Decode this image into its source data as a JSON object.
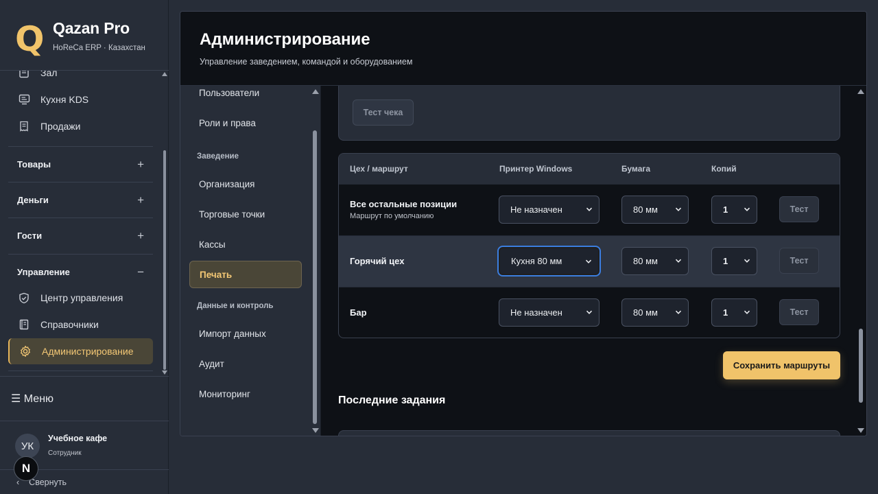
{
  "brand": {
    "logo_letter": "Q",
    "name": "Qazan Pro",
    "subtitle": "HoReCa ERP · Казахстан"
  },
  "sidebar": {
    "items_top": [
      {
        "label": "Зал",
        "icon": "hall-icon"
      },
      {
        "label": "Кухня KDS",
        "icon": "kds-monitor-icon"
      },
      {
        "label": "Продажи",
        "icon": "receipt-icon"
      }
    ],
    "groups": [
      {
        "label": "Товары",
        "toggle": "+"
      },
      {
        "label": "Деньги",
        "toggle": "+"
      },
      {
        "label": "Гости",
        "toggle": "+"
      },
      {
        "label": "Управление",
        "toggle": "−"
      }
    ],
    "items_management": [
      {
        "label": "Центр управления",
        "icon": "shield-check-icon"
      },
      {
        "label": "Справочники",
        "icon": "book-icon"
      },
      {
        "label": "Администрирование",
        "icon": "gear-icon",
        "active": true
      }
    ],
    "menu_label": "☰ Меню",
    "user": {
      "initials": "УК",
      "name": "Учебное кафе",
      "role": "Сотрудник"
    },
    "collapse_label": "Свернуть",
    "collapse_chevron": "‹",
    "n_badge": "N"
  },
  "page": {
    "title": "Администрирование",
    "subtitle": "Управление заведением, командой и оборудованием"
  },
  "subnav": {
    "items_top": [
      "Пользователи",
      "Роли и права"
    ],
    "section_venue": "Заведение",
    "items_venue": [
      "Организация",
      "Торговые точки",
      "Кассы",
      "Печать"
    ],
    "active": "Печать",
    "section_data": "Данные и контроль",
    "items_data": [
      "Импорт данных",
      "Аудит",
      "Мониторинг"
    ]
  },
  "printing": {
    "test_receipt_label": "Тест чека",
    "table_headers": {
      "route": "Цех / маршрут",
      "printer": "Принтер Windows",
      "paper": "Бумага",
      "copies": "Копий"
    },
    "rows": [
      {
        "name": "Все остальные позиции",
        "sub": "Маршрут по умолчанию",
        "printer": "Не назначен",
        "paper": "80 мм",
        "copies": "1",
        "test": "Тест"
      },
      {
        "name": "Горячий цех",
        "sub": "",
        "printer": "Кухня 80 мм",
        "paper": "80 мм",
        "copies": "1",
        "test": "Тест",
        "highlighted": true
      },
      {
        "name": "Бар",
        "sub": "",
        "printer": "Не назначен",
        "paper": "80 мм",
        "copies": "1",
        "test": "Тест"
      }
    ],
    "save_label": "Сохранить маршруты",
    "recent_jobs_title": "Последние задания"
  },
  "colors": {
    "accent": "#f0c36a",
    "focus_ring": "#3b7ee0",
    "active_bg": "#4a4637"
  }
}
